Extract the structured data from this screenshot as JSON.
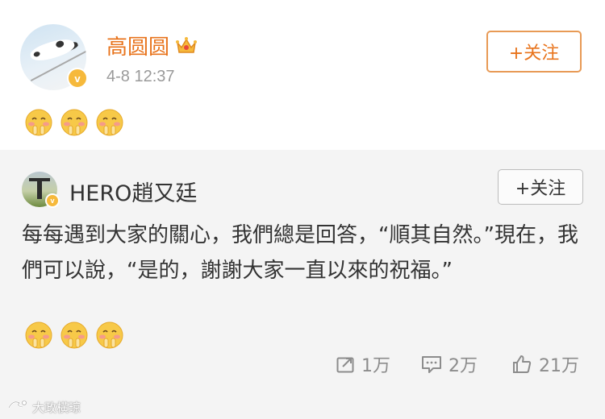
{
  "post": {
    "author": "高圆圆",
    "time": "4-8 12:37",
    "follow_label": "+关注",
    "emoji_count": 3
  },
  "repost": {
    "author": "HERO趙又廷",
    "follow_label": "+关注",
    "text": "每每遇到大家的關心，我們總是回答，“順其自然。”現在，我們可以說，“是的，謝謝大家一直以來的祝福。”",
    "stats": {
      "share": "1万",
      "comment": "2万",
      "like": "21万"
    }
  },
  "watermark": {
    "text": "大政橫琼"
  },
  "colors": {
    "author_orange": "#e8731b",
    "verified_gold": "#f6b93b",
    "repost_bg": "#f4f4f4",
    "emoji_yellow": "#f7c948"
  },
  "icons": {
    "verified": "verified-v-icon",
    "crown": "crown-icon",
    "share": "share-icon",
    "comment": "comment-icon",
    "like": "thumbs-up-icon",
    "emoji": "hugging-blush-emoji"
  }
}
